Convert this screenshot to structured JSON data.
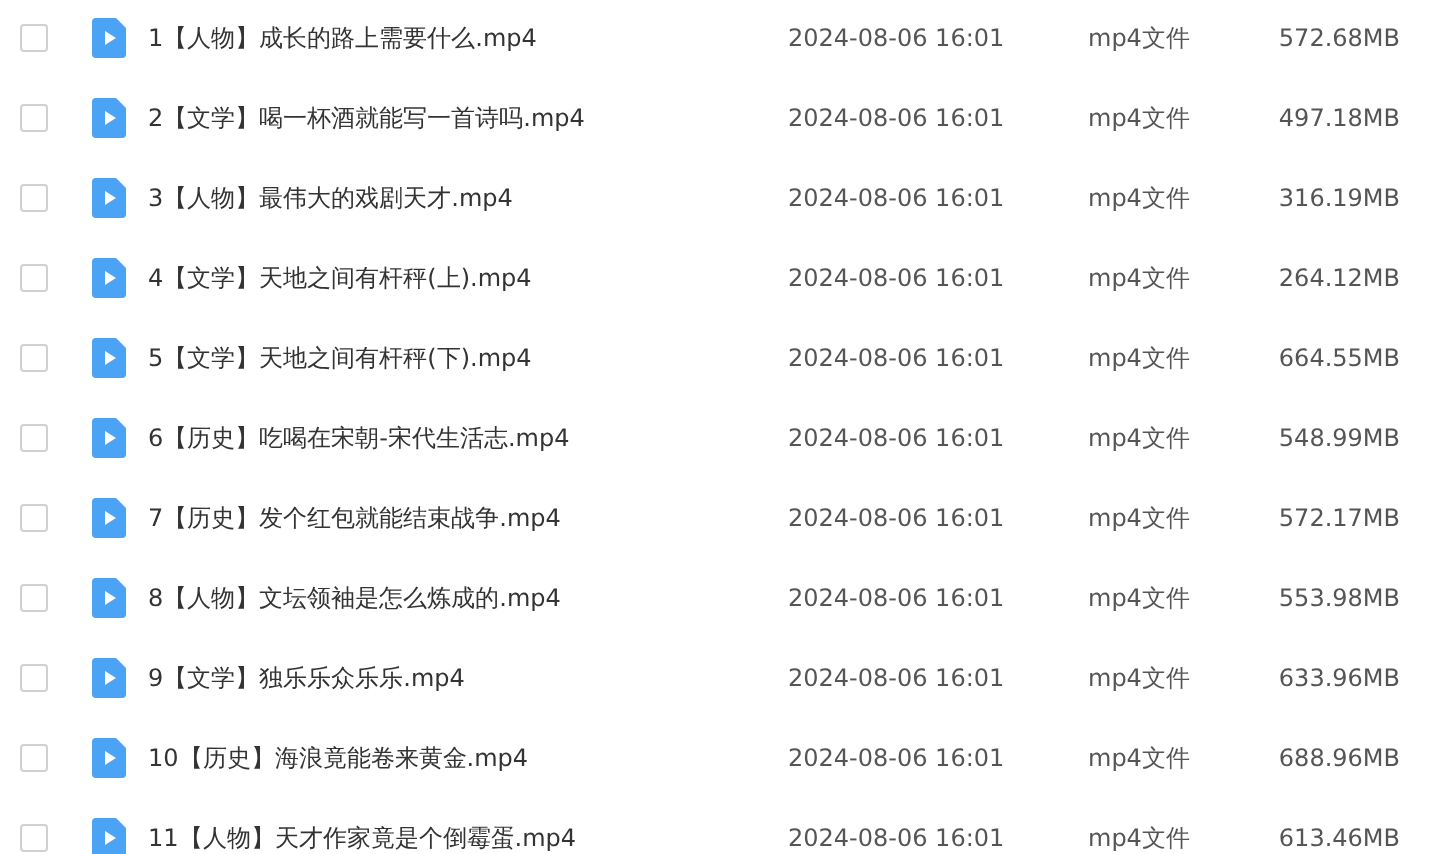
{
  "files": [
    {
      "name": "1【人物】成长的路上需要什么.mp4",
      "modified": "2024-08-06 16:01",
      "type": "mp4文件",
      "size": "572.68MB",
      "checked": false
    },
    {
      "name": "2【文学】喝一杯酒就能写一首诗吗.mp4",
      "modified": "2024-08-06 16:01",
      "type": "mp4文件",
      "size": "497.18MB",
      "checked": false
    },
    {
      "name": "3【人物】最伟大的戏剧天才.mp4",
      "modified": "2024-08-06 16:01",
      "type": "mp4文件",
      "size": "316.19MB",
      "checked": false
    },
    {
      "name": "4【文学】天地之间有杆秤(上).mp4",
      "modified": "2024-08-06 16:01",
      "type": "mp4文件",
      "size": "264.12MB",
      "checked": false
    },
    {
      "name": "5【文学】天地之间有杆秤(下).mp4",
      "modified": "2024-08-06 16:01",
      "type": "mp4文件",
      "size": "664.55MB",
      "checked": false
    },
    {
      "name": "6【历史】吃喝在宋朝-宋代生活志.mp4",
      "modified": "2024-08-06 16:01",
      "type": "mp4文件",
      "size": "548.99MB",
      "checked": false
    },
    {
      "name": "7【历史】发个红包就能结束战争.mp4",
      "modified": "2024-08-06 16:01",
      "type": "mp4文件",
      "size": "572.17MB",
      "checked": false
    },
    {
      "name": "8【人物】文坛领袖是怎么炼成的.mp4",
      "modified": "2024-08-06 16:01",
      "type": "mp4文件",
      "size": "553.98MB",
      "checked": false
    },
    {
      "name": "9【文学】独乐乐众乐乐.mp4",
      "modified": "2024-08-06 16:01",
      "type": "mp4文件",
      "size": "633.96MB",
      "checked": false
    },
    {
      "name": "10【历史】海浪竟能卷来黄金.mp4",
      "modified": "2024-08-06 16:01",
      "type": "mp4文件",
      "size": "688.96MB",
      "checked": false
    },
    {
      "name": "11【人物】天才作家竟是个倒霉蛋.mp4",
      "modified": "2024-08-06 16:01",
      "type": "mp4文件",
      "size": "613.46MB",
      "checked": false
    }
  ]
}
